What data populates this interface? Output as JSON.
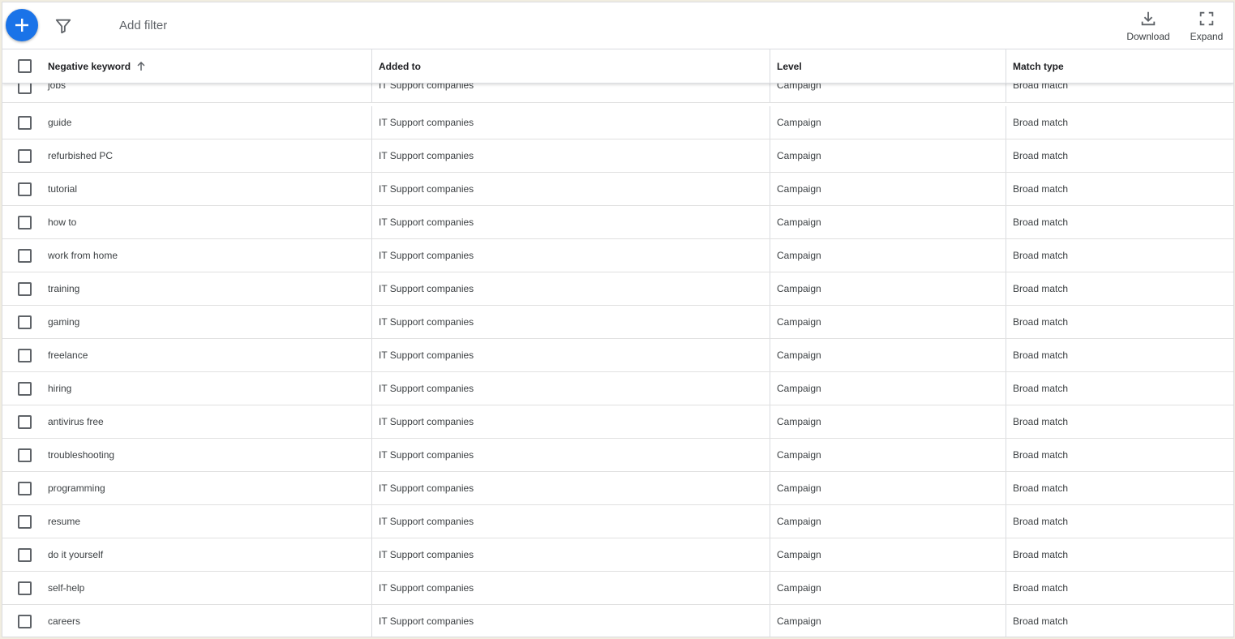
{
  "toolbar": {
    "add_filter": "Add filter",
    "download_label": "Download",
    "expand_label": "Expand"
  },
  "colors": {
    "accent": "#1a73e8"
  },
  "table": {
    "headers": {
      "keyword": "Negative keyword",
      "added_to": "Added to",
      "level": "Level",
      "match_type": "Match type"
    },
    "rows": [
      {
        "keyword": "jobs",
        "added_to": "IT Support companies",
        "level": "Campaign",
        "match_type": "Broad match"
      },
      {
        "keyword": "guide",
        "added_to": "IT Support companies",
        "level": "Campaign",
        "match_type": "Broad match"
      },
      {
        "keyword": "refurbished PC",
        "added_to": "IT Support companies",
        "level": "Campaign",
        "match_type": "Broad match"
      },
      {
        "keyword": "tutorial",
        "added_to": "IT Support companies",
        "level": "Campaign",
        "match_type": "Broad match"
      },
      {
        "keyword": "how to",
        "added_to": "IT Support companies",
        "level": "Campaign",
        "match_type": "Broad match"
      },
      {
        "keyword": "work from home",
        "added_to": "IT Support companies",
        "level": "Campaign",
        "match_type": "Broad match"
      },
      {
        "keyword": "training",
        "added_to": "IT Support companies",
        "level": "Campaign",
        "match_type": "Broad match"
      },
      {
        "keyword": "gaming",
        "added_to": "IT Support companies",
        "level": "Campaign",
        "match_type": "Broad match"
      },
      {
        "keyword": "freelance",
        "added_to": "IT Support companies",
        "level": "Campaign",
        "match_type": "Broad match"
      },
      {
        "keyword": "hiring",
        "added_to": "IT Support companies",
        "level": "Campaign",
        "match_type": "Broad match"
      },
      {
        "keyword": "antivirus free",
        "added_to": "IT Support companies",
        "level": "Campaign",
        "match_type": "Broad match"
      },
      {
        "keyword": "troubleshooting",
        "added_to": "IT Support companies",
        "level": "Campaign",
        "match_type": "Broad match"
      },
      {
        "keyword": "programming",
        "added_to": "IT Support companies",
        "level": "Campaign",
        "match_type": "Broad match"
      },
      {
        "keyword": "resume",
        "added_to": "IT Support companies",
        "level": "Campaign",
        "match_type": "Broad match"
      },
      {
        "keyword": "do it yourself",
        "added_to": "IT Support companies",
        "level": "Campaign",
        "match_type": "Broad match"
      },
      {
        "keyword": "self-help",
        "added_to": "IT Support companies",
        "level": "Campaign",
        "match_type": "Broad match"
      },
      {
        "keyword": "careers",
        "added_to": "IT Support companies",
        "level": "Campaign",
        "match_type": "Broad match"
      }
    ]
  }
}
